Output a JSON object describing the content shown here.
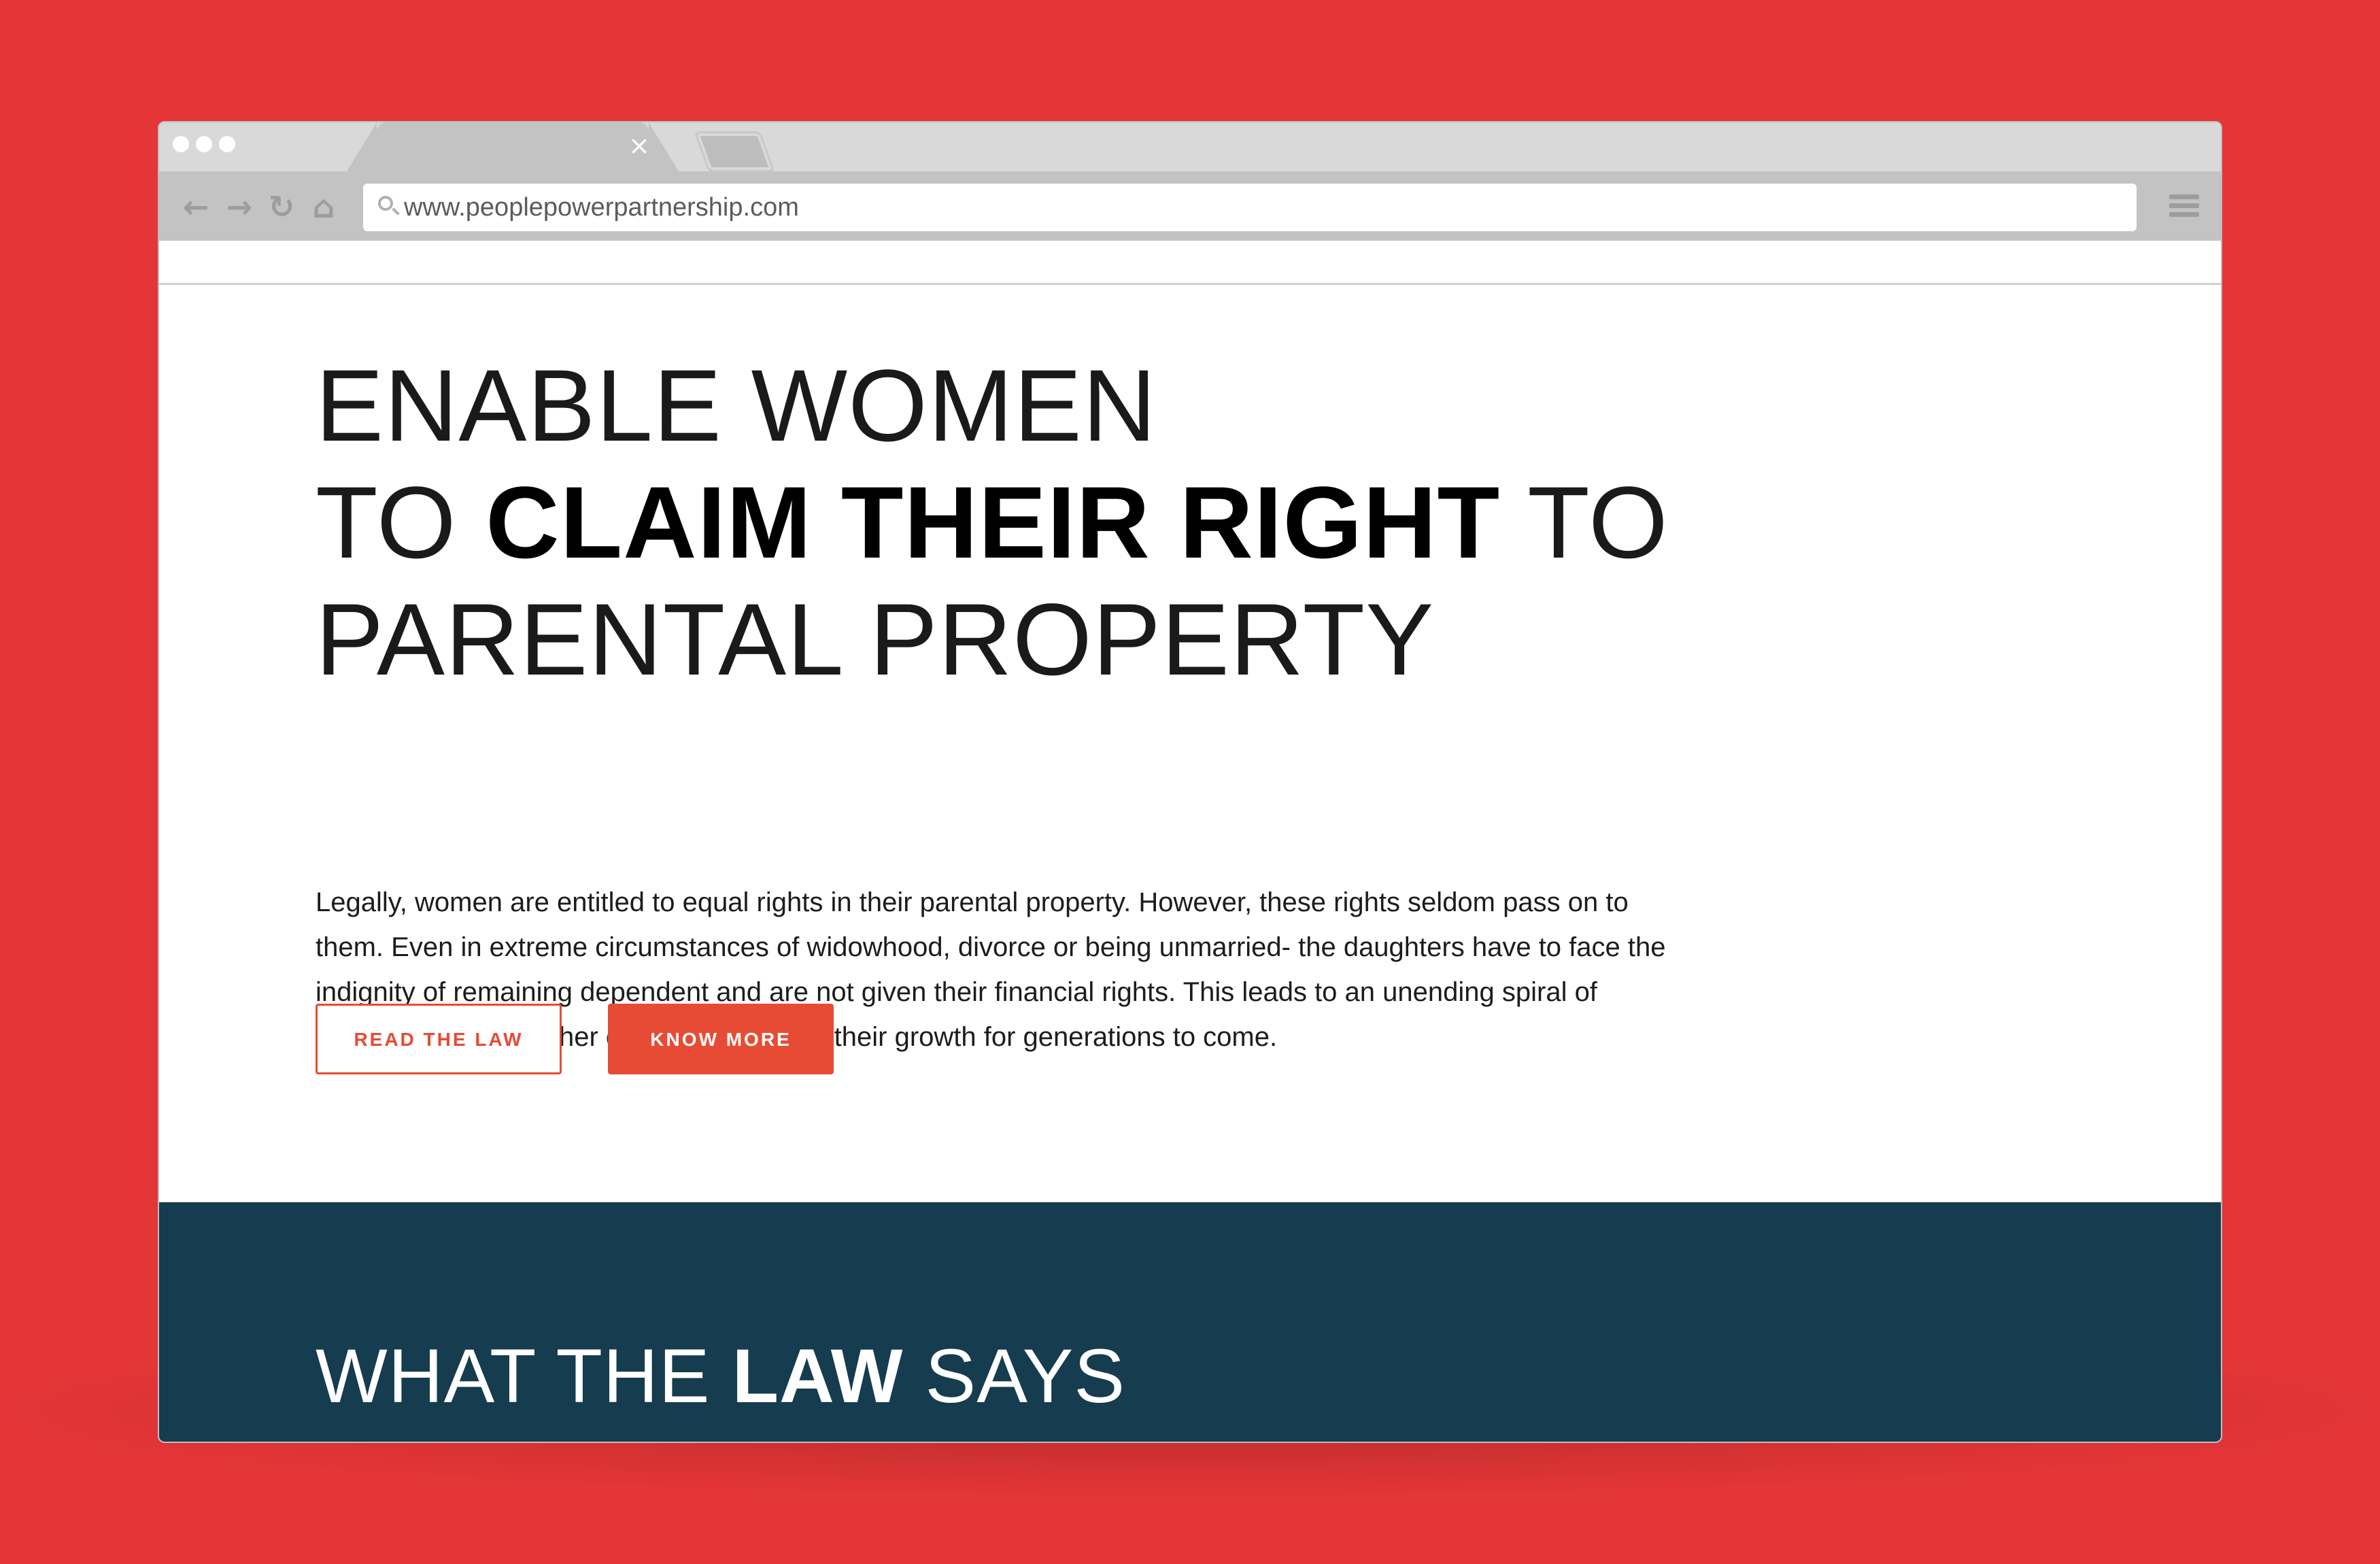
{
  "browser": {
    "url": "www.peoplepowerpartnership.com",
    "tab_close": "×",
    "nav": {
      "back": "←",
      "forward": "→",
      "reload": "↻",
      "home": "⌂"
    },
    "icons": [
      "search-icon",
      "menu-icon",
      "close-icon"
    ]
  },
  "hero": {
    "line1": "ENABLE WOMEN",
    "line2_pre": "TO ",
    "line2_bold": "CLAIM THEIR RIGHT",
    "line2_post": " TO",
    "line3": "PARENTAL PROPERTY",
    "body": "Legally, women are entitled to equal rights in their parental property. However, these rights seldom pass on to them. Even in extreme circumstances of widowhood, divorce or being unmarried- the daughters have to face the indignity of remaining dependent and are not given their financial rights. This leads to an unending spiral of struggle for her and her children, depriving their growth for generations to come.",
    "read_law_label": "READ THE LAW",
    "know_more_label": "KNOW MORE"
  },
  "law_section": {
    "title_pre": "WHAT THE ",
    "title_bold": "LAW",
    "title_post": " SAYS"
  },
  "colors": {
    "background": "#e43537",
    "accent": "#e84b33",
    "navy": "#153c4f"
  }
}
